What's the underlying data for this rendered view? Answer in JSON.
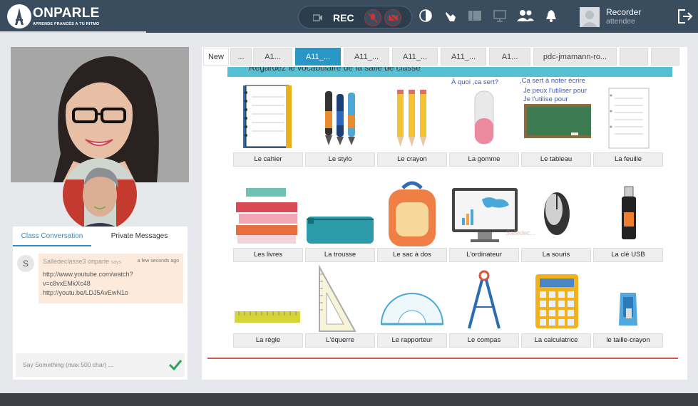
{
  "header": {
    "logo_text": "ONPARLE",
    "logo_tagline": "APRENDE FRANCÉS A TU RITMO",
    "rec_label": "REC",
    "user_name": "Recorder",
    "user_role": "attendee",
    "icons": [
      "record-icon",
      "mic-off-icon",
      "camera-off-icon",
      "contrast-icon",
      "raise-hand-icon",
      "whiteboard-icon",
      "screen-share-icon",
      "users-icon",
      "bell-icon",
      "avatar",
      "logout-icon"
    ]
  },
  "chat": {
    "tab_class": "Class Conversation",
    "tab_private": "Private Messages",
    "avatar_initial": "S",
    "message": {
      "author": "Salledeclasse3 onparle",
      "says": "says",
      "time": "a few seconds ago",
      "lines": [
        "http://www.youtube.com/watch?",
        "v=c8vxEMkXc48",
        "http://youtu.be/LDJ5AvEwN1o"
      ]
    },
    "input_placeholder": "Say Something (max 500 char) ..."
  },
  "board": {
    "tabs": [
      {
        "label": "New"
      },
      {
        "label": "..."
      },
      {
        "label": "A1..."
      },
      {
        "label": "A11_..."
      },
      {
        "label": "A11_..."
      },
      {
        "label": "A11_..."
      },
      {
        "label": "A11_..."
      },
      {
        "label": "A1..."
      },
      {
        "label": "pdc-jmamann-ro..."
      },
      {
        "label": "..."
      },
      {
        "label": "..."
      }
    ],
    "banner": "Regardez le vocabulaire de la salle de classe",
    "notes": {
      "a": "À quoi ,ca sert?",
      "b": ",Ca sert à noter écrire",
      "c": "Je peux l'utiliser pour",
      "d": "Je l'utilise pour"
    },
    "watermark": "Salledec...",
    "items": [
      {
        "label": "Le cahier",
        "icon": "notebook-icon"
      },
      {
        "label": "Le stylo",
        "icon": "pen-icon"
      },
      {
        "label": "Le crayon",
        "icon": "pencil-icon"
      },
      {
        "label": "La gomme",
        "icon": "eraser-icon"
      },
      {
        "label": "Le tableau",
        "icon": "chalkboard-icon"
      },
      {
        "label": "La feuille",
        "icon": "paper-sheet-icon"
      },
      {
        "label": "Les livres",
        "icon": "books-icon"
      },
      {
        "label": "La trousse",
        "icon": "pencil-case-icon"
      },
      {
        "label": "Le sac à dos",
        "icon": "backpack-icon"
      },
      {
        "label": "L'ordinateur",
        "icon": "computer-icon"
      },
      {
        "label": "La souris",
        "icon": "mouse-icon"
      },
      {
        "label": "La clé USB",
        "icon": "usb-key-icon"
      },
      {
        "label": "La règle",
        "icon": "ruler-icon"
      },
      {
        "label": "L'équerre",
        "icon": "set-square-icon"
      },
      {
        "label": "Le rapporteur",
        "icon": "protractor-icon"
      },
      {
        "label": "Le compas",
        "icon": "compass-icon"
      },
      {
        "label": "La calculatrice",
        "icon": "calculator-icon"
      },
      {
        "label": "le taille-crayon",
        "icon": "sharpener-icon"
      }
    ]
  },
  "colors": {
    "topbar": "#3a4d5f",
    "accent": "#2897c8",
    "banner": "#56bfd3"
  }
}
